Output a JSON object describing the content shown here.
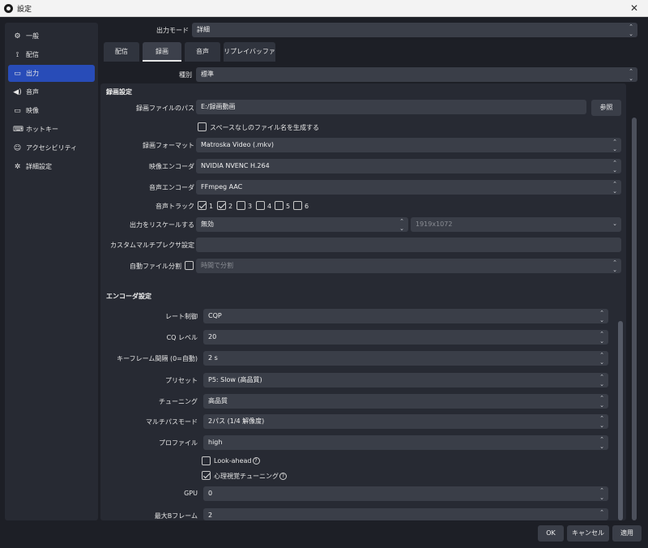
{
  "window": {
    "title": "設定",
    "close_glyph": "✕"
  },
  "sidebar": {
    "items": [
      {
        "label": "一般",
        "icon": "gear-icon",
        "glyph": "⚙"
      },
      {
        "label": "配信",
        "icon": "antenna-icon",
        "glyph": "📶"
      },
      {
        "label": "出力",
        "icon": "output-monitor-icon",
        "glyph": "🖵"
      },
      {
        "label": "音声",
        "icon": "speaker-icon",
        "glyph": "🔊"
      },
      {
        "label": "映像",
        "icon": "monitor-icon",
        "glyph": "🖥"
      },
      {
        "label": "ホットキー",
        "icon": "keyboard-icon",
        "glyph": "⌨"
      },
      {
        "label": "アクセシビリティ",
        "icon": "accessibility-icon",
        "glyph": "♿"
      },
      {
        "label": "詳細設定",
        "icon": "wrench-icon",
        "glyph": "✲"
      }
    ],
    "active_index": 2,
    "active_color": "#284cb8"
  },
  "output_mode": {
    "label": "出力モード",
    "value": "詳細"
  },
  "tabs": [
    "配信",
    "録画",
    "音声",
    "リプレイバッファ"
  ],
  "active_tab": 1,
  "type_row": {
    "label": "種別",
    "value": "標準"
  },
  "recording": {
    "title": "録画設定",
    "path_label": "録画ファイルのパス",
    "path_value": "E:/録画動画",
    "browse_label": "参照",
    "no_space_label": "スペースなしのファイル名を生成する",
    "no_space_checked": false,
    "format_label": "録画フォーマット",
    "format_value": "Matroska Video (.mkv)",
    "video_encoder_label": "映像エンコーダ",
    "video_encoder_value": "NVIDIA NVENC H.264",
    "audio_encoder_label": "音声エンコーダ",
    "audio_encoder_value": "FFmpeg AAC",
    "audio_track_label": "音声トラック",
    "tracks": [
      {
        "label": "1",
        "checked": true
      },
      {
        "label": "2",
        "checked": true
      },
      {
        "label": "3",
        "checked": false
      },
      {
        "label": "4",
        "checked": false
      },
      {
        "label": "5",
        "checked": false
      },
      {
        "label": "6",
        "checked": false
      }
    ],
    "rescale_label": "出力をリスケールする",
    "rescale_value": "無効",
    "rescale_resolution": "1919x1072",
    "muxer_label": "カスタムマルチプレクサ設定",
    "muxer_value": "",
    "auto_split_label": "自動ファイル分割",
    "auto_split_checked": false,
    "auto_split_value": "時間で分割"
  },
  "encoder": {
    "title": "エンコーダ設定",
    "rate_control_label": "レート制御",
    "rate_control_value": "CQP",
    "cq_label": "CQ レベル",
    "cq_value": "20",
    "keyframe_label": "キーフレーム間隔 (0=自動)",
    "keyframe_value": "2 s",
    "preset_label": "プリセット",
    "preset_value": "P5: Slow (高品質)",
    "tuning_label": "チューニング",
    "tuning_value": "高品質",
    "multipass_label": "マルチパスモード",
    "multipass_value": "2パス (1/4 解像度)",
    "profile_label": "プロファイル",
    "profile_value": "high",
    "lookahead_label": "Look-ahead",
    "lookahead_checked": false,
    "psycho_label": "心理視覚チューニング",
    "psycho_checked": true,
    "gpu_label": "GPU",
    "gpu_value": "0",
    "bframes_label": "最大Bフレーム",
    "bframes_value": "2"
  },
  "footer": {
    "ok": "OK",
    "cancel": "キャンセル",
    "apply": "適用"
  },
  "glyphs": {
    "updown": "⌃⌄",
    "down": "⌄",
    "help": "?"
  }
}
